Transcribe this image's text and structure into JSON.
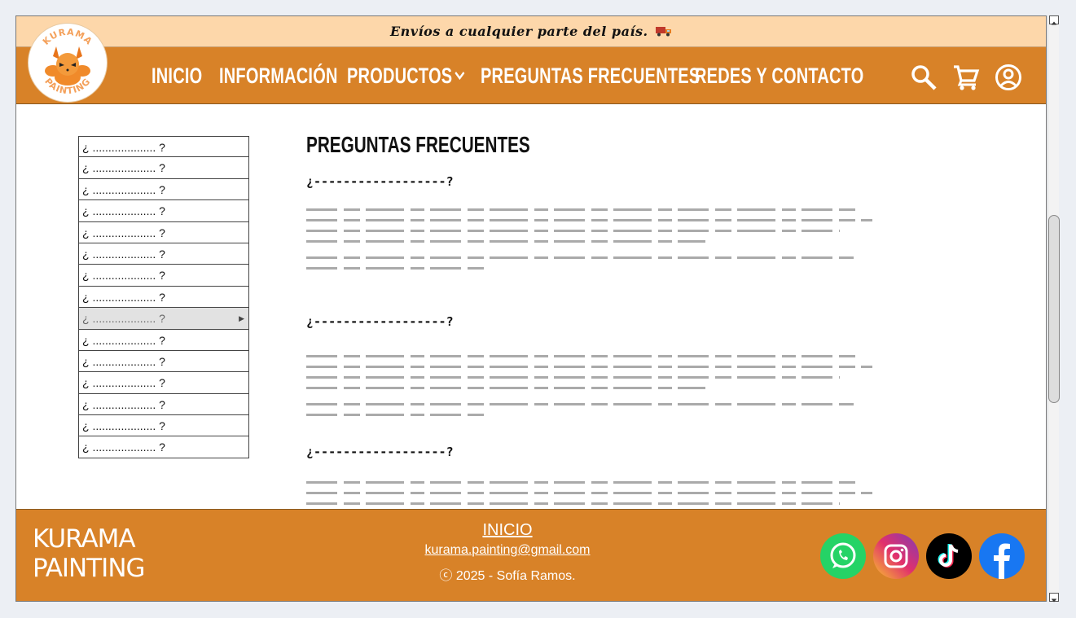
{
  "announcement": {
    "text": "Envíos a cualquier parte del país."
  },
  "logo": {
    "top_text": "KURAMA",
    "bottom_text": "PAINTING"
  },
  "nav": {
    "items": [
      {
        "label": "INICIO"
      },
      {
        "label": "INFORMACIÓN"
      },
      {
        "label": "PRODUCTOS"
      },
      {
        "label": "PREGUNTAS FRECUENTES"
      },
      {
        "label": "REDES Y CONTACTO"
      }
    ]
  },
  "faq_sidebar": {
    "items": [
      "¿ .................... ?",
      "¿ .................... ?",
      "¿ .................... ?",
      "¿ .................... ?",
      "¿ .................... ?",
      "¿ .................... ?",
      "¿ .................... ?",
      "¿ .................... ?",
      "¿ .................... ?",
      "¿ .................... ?",
      "¿ .................... ?",
      "¿ .................... ?",
      "¿ .................... ?",
      "¿ .................... ?",
      "¿ .................... ?"
    ],
    "active_index": 8
  },
  "main": {
    "title": "PREGUNTAS FRECUENTES",
    "questions": [
      {
        "text": "¿------------------?"
      },
      {
        "text": "¿------------------?"
      },
      {
        "text": "¿------------------?"
      }
    ]
  },
  "footer": {
    "brand_line1": "KURAMA",
    "brand_line2": "PAINTING",
    "home_link": "INICIO",
    "email": "kurama.painting@gmail.com",
    "copyright": "ⓒ 2025 - Sofía Ramos."
  },
  "colors": {
    "header": "#d88228",
    "announcement_bg": "#fdd7aa",
    "whatsapp": "#25d366",
    "tiktok": "#000000",
    "facebook": "#1877f2"
  }
}
